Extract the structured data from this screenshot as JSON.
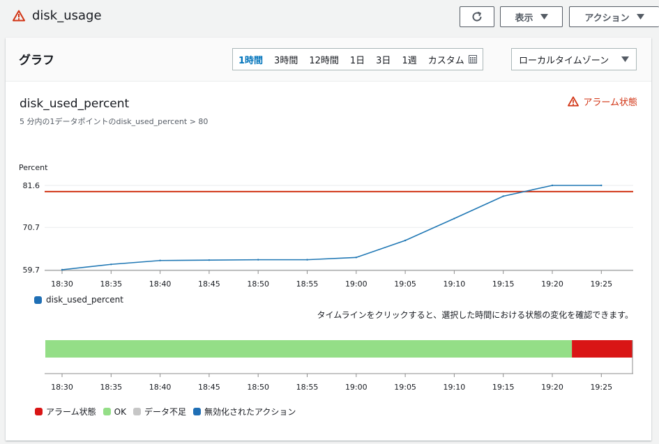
{
  "header": {
    "alarm_name": "disk_usage",
    "refresh_button": "refresh",
    "view_button": "表示",
    "actions_button": "アクション"
  },
  "panel": {
    "title": "グラフ",
    "time_ranges": [
      "1時間",
      "3時間",
      "12時間",
      "1日",
      "3日",
      "1週",
      "カスタム"
    ],
    "active_range": "1時間",
    "timezone": "ローカルタイムゾーン"
  },
  "metric": {
    "name": "disk_used_percent",
    "description": "5 分内の1データポイントのdisk_used_percent > 80",
    "alarm_state_label": "アラーム状態"
  },
  "chart_data": {
    "type": "line",
    "ylabel": "Percent",
    "yticks": [
      "81.6",
      "70.7",
      "59.7"
    ],
    "ylim": [
      59.7,
      81.6
    ],
    "x": [
      "18:30",
      "18:35",
      "18:40",
      "18:45",
      "18:50",
      "18:55",
      "19:00",
      "19:05",
      "19:10",
      "19:15",
      "19:20",
      "19:25"
    ],
    "series": [
      {
        "name": "disk_used_percent",
        "color": "#1f77b4",
        "values": [
          59.7,
          61.1,
          62.1,
          62.2,
          62.3,
          62.3,
          62.9,
          67.3,
          73.0,
          78.8,
          81.6,
          81.6
        ]
      }
    ],
    "threshold": 80,
    "threshold_color": "#d13212",
    "legend": "bottom-left"
  },
  "timeline": {
    "hint": "タイムラインをクリックすると、選択した時間における状態の変化を確認できます。",
    "ok_until": "19:22",
    "states": [
      {
        "label": "アラーム状態",
        "color": "#d91515"
      },
      {
        "label": "OK",
        "color": "#94de87"
      },
      {
        "label": "データ不足",
        "color": "#c6c6c6"
      },
      {
        "label": "無効化されたアクション",
        "color": "#1f6fb5"
      }
    ]
  }
}
